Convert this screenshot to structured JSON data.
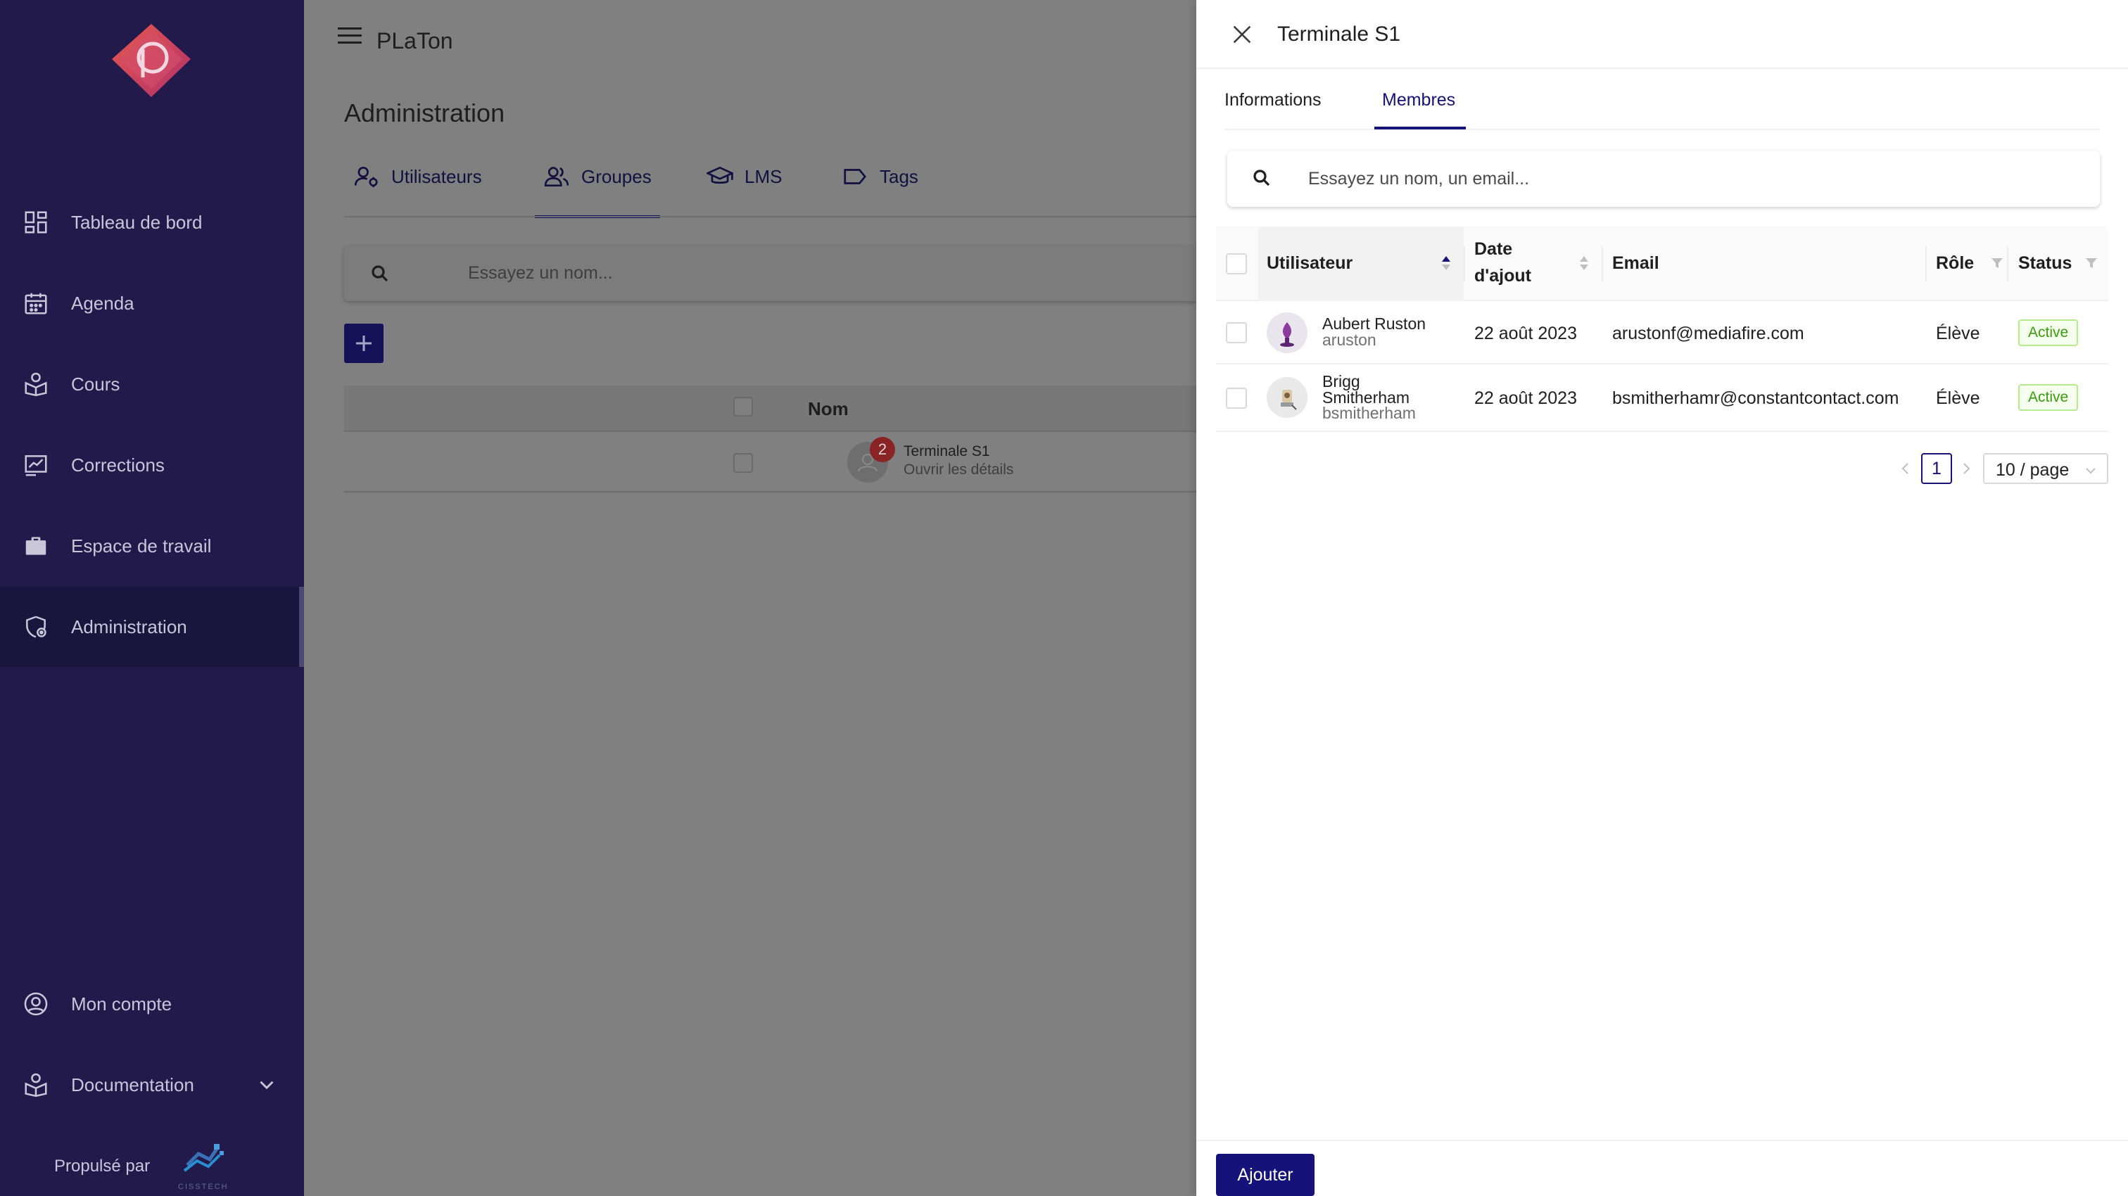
{
  "app": {
    "title": "PLaTon"
  },
  "sidebar": {
    "items": [
      {
        "label": "Tableau de bord",
        "icon": "dashboard-icon"
      },
      {
        "label": "Agenda",
        "icon": "calendar-icon"
      },
      {
        "label": "Cours",
        "icon": "course-icon"
      },
      {
        "label": "Corrections",
        "icon": "corrections-icon"
      },
      {
        "label": "Espace de travail",
        "icon": "briefcase-icon"
      },
      {
        "label": "Administration",
        "icon": "admin-icon",
        "active": true
      }
    ],
    "bottom_items": [
      {
        "label": "Mon compte",
        "icon": "account-icon"
      },
      {
        "label": "Documentation",
        "icon": "documentation-icon"
      }
    ],
    "powered_by": "Propulsé par",
    "powered_brand": "CISSTECH"
  },
  "main": {
    "page_title": "Administration",
    "tabs": [
      {
        "label": "Utilisateurs",
        "icon": "users-settings-icon"
      },
      {
        "label": "Groupes",
        "icon": "groups-icon",
        "active": true
      },
      {
        "label": "LMS",
        "icon": "graduation-cap-icon"
      },
      {
        "label": "Tags",
        "icon": "tag-icon"
      }
    ],
    "search_placeholder": "Essayez un nom...",
    "table": {
      "column_name": "Nom",
      "rows": [
        {
          "name": "Terminale S1",
          "subtitle": "Ouvrir les détails",
          "badge": "2"
        }
      ]
    }
  },
  "drawer": {
    "title": "Terminale S1",
    "tabs": [
      {
        "label": "Informations"
      },
      {
        "label": "Membres",
        "active": true
      }
    ],
    "search_placeholder": "Essayez un nom, un email...",
    "columns": {
      "user": "Utilisateur",
      "date_line1": "Date",
      "date_line2": "d'ajout",
      "email": "Email",
      "role": "Rôle",
      "status": "Status"
    },
    "members": [
      {
        "name_line1": "Aubert Ruston",
        "name_line2": "",
        "login": "aruston",
        "date": "22 août 2023",
        "email": "arustonf@mediafire.com",
        "role": "Élève",
        "status": "Active"
      },
      {
        "name_line1": "Brigg",
        "name_line2": "Smitherham",
        "login": "bsmitherham",
        "date": "22 août 2023",
        "email": "bsmitherhamr@constantcontact.com",
        "role": "Élève",
        "status": "Active"
      }
    ],
    "pagination": {
      "current_page": "1",
      "page_size": "10 / page"
    },
    "footer": {
      "add_button": "Ajouter"
    }
  },
  "colors": {
    "sidebar_bg": "#211a4a",
    "primary": "#15127a",
    "status_active_text": "#389e0d",
    "status_active_bg": "#f6ffed"
  }
}
